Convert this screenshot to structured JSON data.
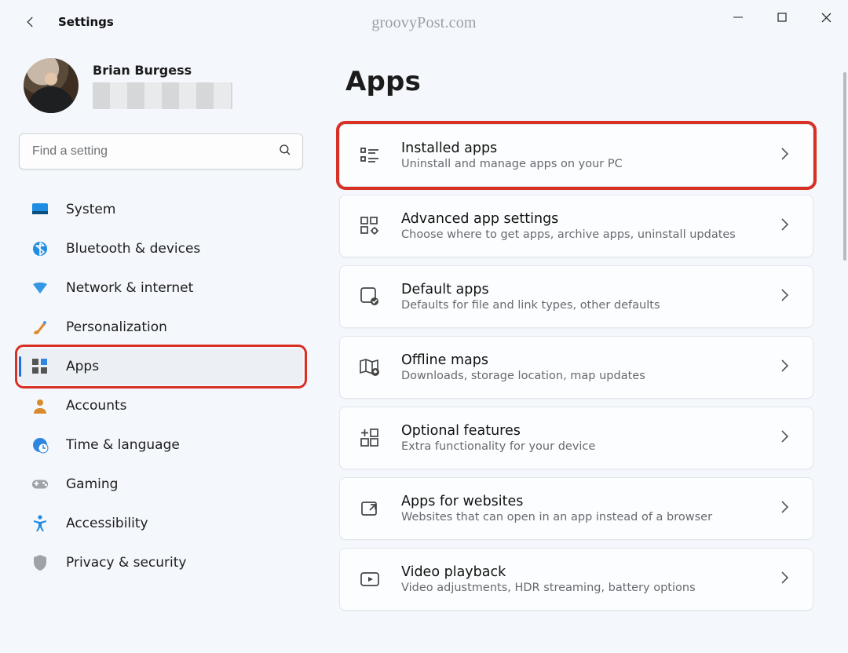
{
  "window": {
    "title": "Settings",
    "watermark": "groovyPost.com"
  },
  "account": {
    "name": "Brian Burgess"
  },
  "search": {
    "placeholder": "Find a setting"
  },
  "nav": {
    "items": [
      {
        "key": "system",
        "label": "System"
      },
      {
        "key": "bluetooth",
        "label": "Bluetooth & devices"
      },
      {
        "key": "network",
        "label": "Network & internet"
      },
      {
        "key": "personalization",
        "label": "Personalization"
      },
      {
        "key": "apps",
        "label": "Apps",
        "current": true,
        "highlighted": true
      },
      {
        "key": "accounts",
        "label": "Accounts"
      },
      {
        "key": "time",
        "label": "Time & language"
      },
      {
        "key": "gaming",
        "label": "Gaming"
      },
      {
        "key": "accessibility",
        "label": "Accessibility"
      },
      {
        "key": "privacy",
        "label": "Privacy & security"
      }
    ]
  },
  "page": {
    "title": "Apps",
    "cards": [
      {
        "key": "installed",
        "title": "Installed apps",
        "sub": "Uninstall and manage apps on your PC",
        "highlighted": true
      },
      {
        "key": "advanced",
        "title": "Advanced app settings",
        "sub": "Choose where to get apps, archive apps, uninstall updates"
      },
      {
        "key": "default",
        "title": "Default apps",
        "sub": "Defaults for file and link types, other defaults"
      },
      {
        "key": "offline",
        "title": "Offline maps",
        "sub": "Downloads, storage location, map updates"
      },
      {
        "key": "optional",
        "title": "Optional features",
        "sub": "Extra functionality for your device"
      },
      {
        "key": "websites",
        "title": "Apps for websites",
        "sub": "Websites that can open in an app instead of a browser"
      },
      {
        "key": "video",
        "title": "Video playback",
        "sub": "Video adjustments, HDR streaming, battery options"
      }
    ]
  },
  "colors": {
    "accent": "#1f6fe1",
    "annotation": "#d93025"
  }
}
